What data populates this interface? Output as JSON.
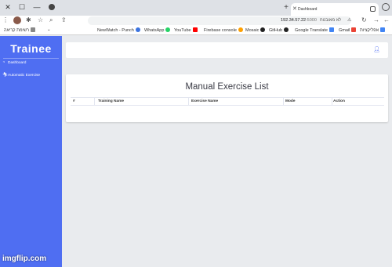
{
  "browser": {
    "tab_title": "Dashboard",
    "url_host": "192.34.57.22",
    "url_port": ":5000",
    "insecure_label": "לא מאובטח"
  },
  "bookmarks": [
    {
      "label": "NewWatch - Punch",
      "icon": "punch-icon",
      "color": "#3b73e0"
    },
    {
      "label": "WhatsApp",
      "icon": "whatsapp-icon",
      "color": "#25d366"
    },
    {
      "label": "YouTube",
      "icon": "youtube-icon",
      "color": "#ff0000"
    },
    {
      "label": "Firebase console",
      "icon": "firebase-icon",
      "color": "#ffa000"
    },
    {
      "label": "Mosaic",
      "icon": "mosaic-icon",
      "color": "#222222"
    },
    {
      "label": "GitHub",
      "icon": "github-icon",
      "color": "#222222"
    },
    {
      "label": "Google Translate",
      "icon": "translate-icon",
      "color": "#4285f4"
    },
    {
      "label": "Gmail",
      "icon": "gmail-icon",
      "color": "#ea4335"
    },
    {
      "label": "אפליקציות",
      "icon": "apps-icon",
      "color": "#4285f4"
    },
    {
      "label": "רשימת קריאה",
      "icon": "reading-list-icon",
      "color": "#555555"
    }
  ],
  "sidebar": {
    "brand": "Trainee",
    "items": [
      {
        "label": "Dashboard",
        "icon": "dashboard-icon"
      },
      {
        "label": "Automatic Exercise",
        "icon": "running-person-icon"
      }
    ]
  },
  "main": {
    "title": "Manual Exercise List",
    "columns": [
      "#",
      "Training Name",
      "Exercise Name",
      "Mode",
      "Action"
    ],
    "rows": []
  },
  "watermark": "imgflip.com",
  "colors": {
    "sidebar_bg": "#4f6ef2",
    "page_bg": "#e9ebee"
  }
}
